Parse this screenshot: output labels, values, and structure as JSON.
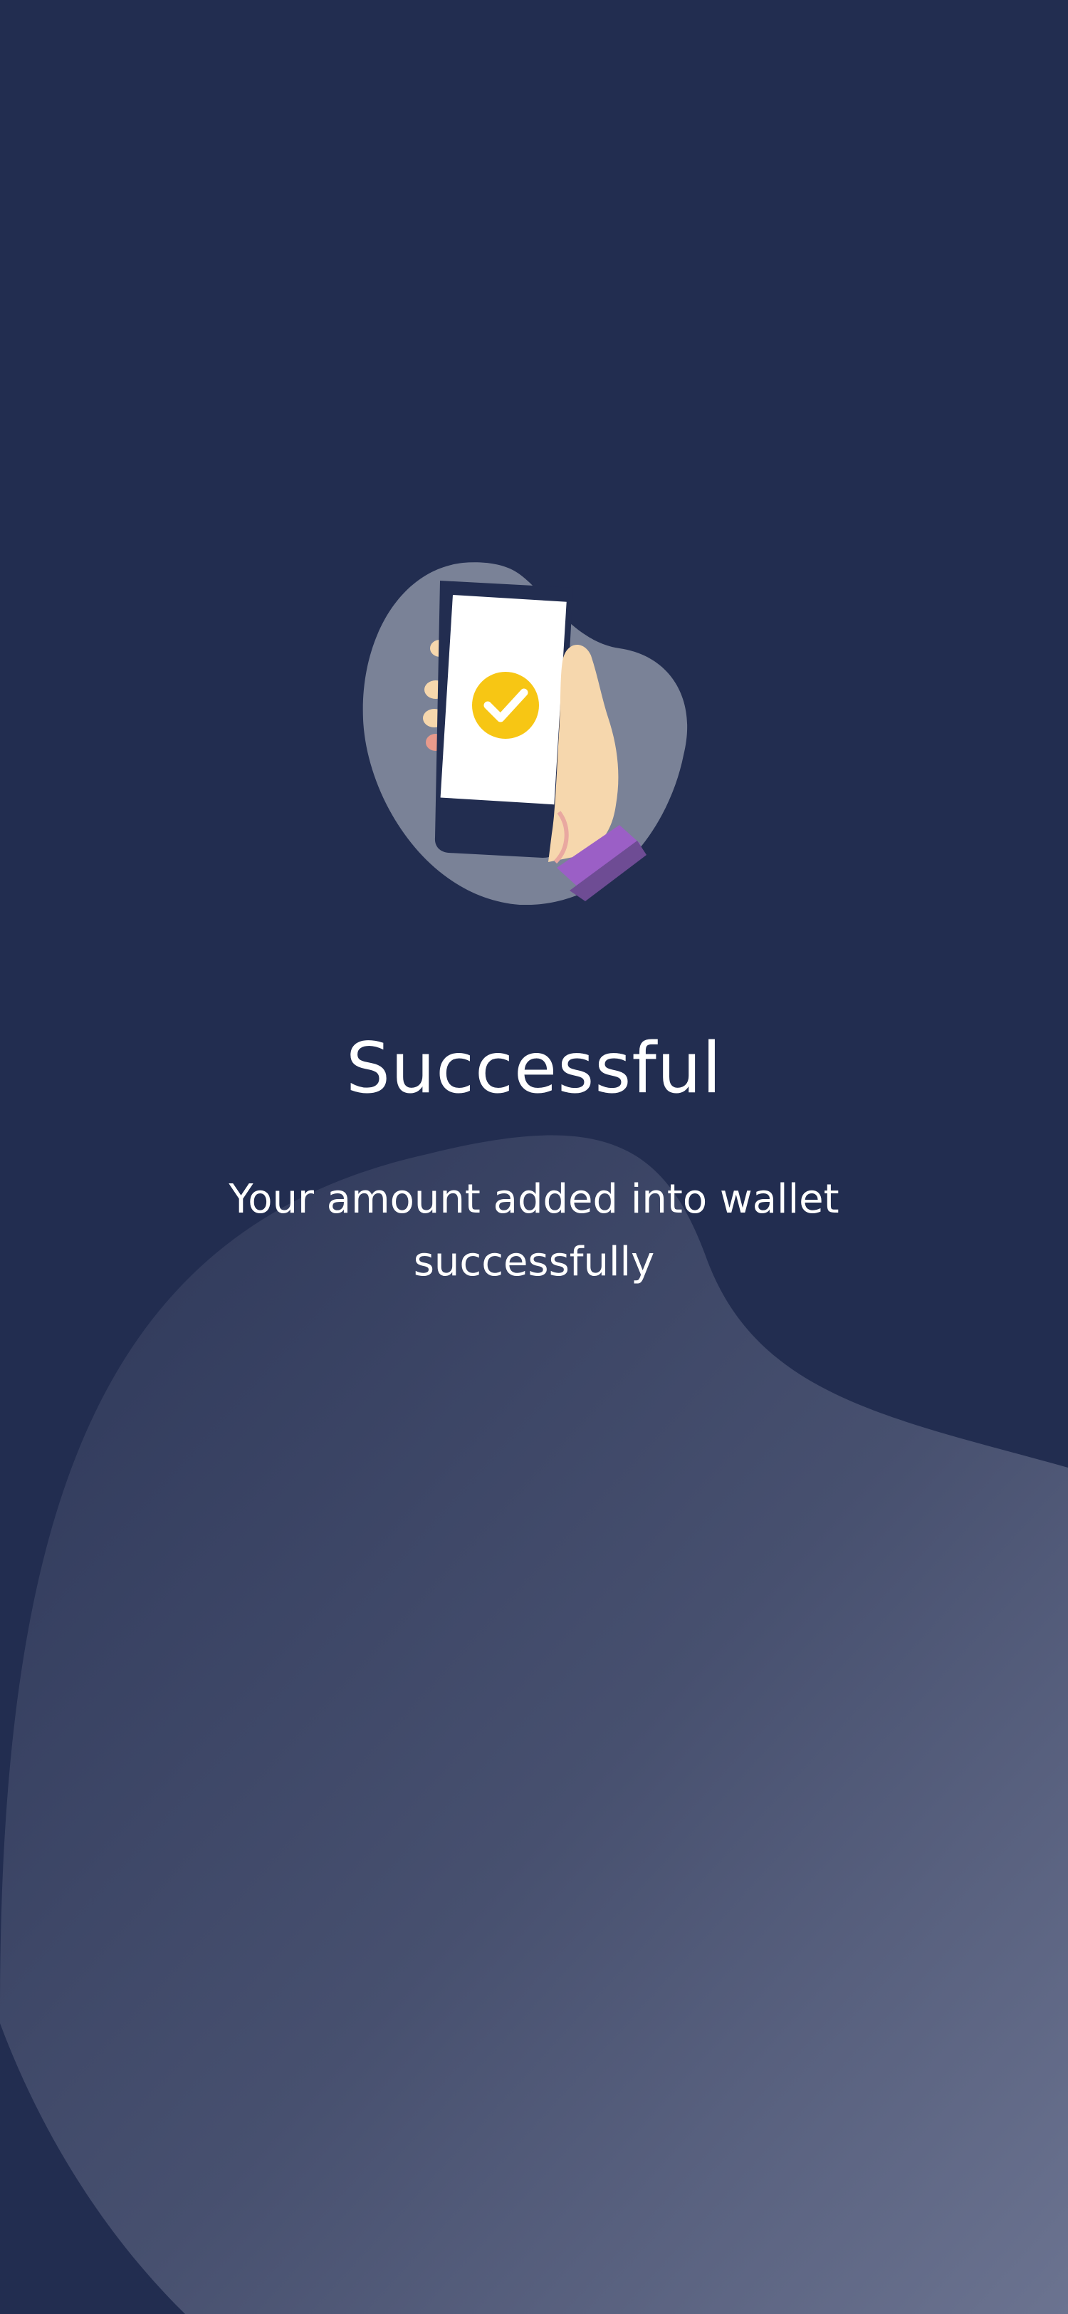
{
  "success_screen": {
    "title": "Successful",
    "message": "Your amount added into wallet successfully",
    "illustration_icon": "hand-holding-phone-checkmark-icon"
  },
  "colors": {
    "background": "#222d50",
    "wave_light": "#6a7290",
    "accent_check": "#f7c614",
    "sleeve": "#9b5fc6",
    "text": "#ffffff"
  }
}
